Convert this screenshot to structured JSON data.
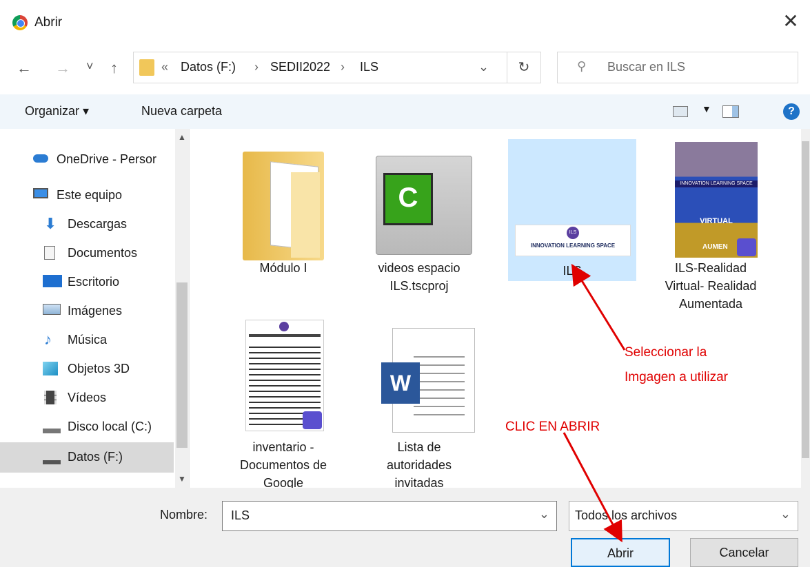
{
  "window": {
    "title": "Abrir",
    "close_glyph": "✕"
  },
  "nav": {
    "back": "←",
    "forward": "→",
    "recent": "˅",
    "up": "↑"
  },
  "breadcrumb": {
    "overflow": "«",
    "items": [
      "Datos (F:)",
      "SEDII2022",
      "ILS"
    ],
    "sep": "›"
  },
  "search": {
    "placeholder": "Buscar en ILS"
  },
  "toolbar": {
    "organize": "Organizar ▾",
    "new_folder": "Nueva carpeta",
    "help": "?"
  },
  "sidebar": {
    "items": [
      {
        "label": "OneDrive - Persor",
        "icon": "cloud-icon"
      },
      {
        "label": "Este equipo",
        "icon": "computer-icon"
      },
      {
        "label": "Descargas",
        "icon": "download-icon"
      },
      {
        "label": "Documentos",
        "icon": "document-icon"
      },
      {
        "label": "Escritorio",
        "icon": "desktop-icon"
      },
      {
        "label": "Imágenes",
        "icon": "pictures-icon"
      },
      {
        "label": "Música",
        "icon": "music-icon"
      },
      {
        "label": "Objetos 3D",
        "icon": "cube-icon"
      },
      {
        "label": "Vídeos",
        "icon": "video-icon"
      },
      {
        "label": "Disco local (C:)",
        "icon": "drive-c-icon"
      },
      {
        "label": "Datos (F:)",
        "icon": "drive-icon"
      }
    ]
  },
  "files": [
    {
      "line1": "Módulo I",
      "line2": "",
      "line3": ""
    },
    {
      "line1": "videos espacio",
      "line2": "ILS.tscproj",
      "line3": ""
    },
    {
      "line1": "ILS",
      "line2": "",
      "line3": ""
    },
    {
      "line1": "ILS-Realidad",
      "line2": "Virtual- Realidad",
      "line3": "Aumentada"
    },
    {
      "line1": "inventario -",
      "line2": "Documentos de",
      "line3": "Google"
    },
    {
      "line1": "Lista de",
      "line2": "autoridades",
      "line3": "invitadas"
    }
  ],
  "thumbs": {
    "ils_banner": "INNOVATION LEARNING SPACE",
    "ils_badge": "ILS",
    "poster_top": "INNOVATION LEARNING SPACE",
    "poster_virtual": "VIRTUAL",
    "poster_aumen": "AUMEN",
    "word_letter": "W",
    "camtasia_letter": "C"
  },
  "annotations": {
    "select_line1": "Seleccionar la",
    "select_line2": "Imgagen a utilizar",
    "click_open": "CLIC EN ABRIR"
  },
  "bottom": {
    "name_label": "Nombre:",
    "name_value": "ILS",
    "type_value": "Todos los archivos",
    "open": "Abrir",
    "cancel": "Cancelar"
  },
  "colors": {
    "accent": "#0078d7",
    "selection": "#cce8ff",
    "annotation": "#e00000"
  }
}
